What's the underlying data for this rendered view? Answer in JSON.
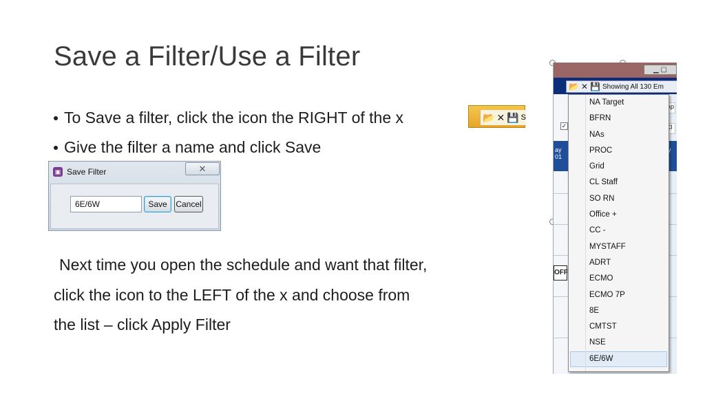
{
  "title": "Save a Filter/Use a Filter",
  "bullets": [
    "To Save a filter, click the icon the RIGHT of the x",
    "Give the filter a name and click Save"
  ],
  "paragraph": [
    "Next time you open the schedule and want that filter,",
    "click the icon to the LEFT of the x and choose from",
    "the list – click Apply Filter"
  ],
  "snippet": {
    "trailing_text": "S"
  },
  "dialog": {
    "title": "Save Filter",
    "name_value": "6E/6W",
    "save_label": "Save",
    "cancel_label": "Cancel"
  },
  "schedule": {
    "showing_text": "Showing All 130 Em",
    "header_left": "ay",
    "header_left_sub": "01",
    "header_right": "y",
    "off_label": "OFF",
    "cell_text_right_1": "Ap",
    "cell_text_right_2": "Cl",
    "filter_list": [
      "NA Target",
      "BFRN",
      "NAs",
      "PROC",
      "Grid",
      "CL Staff",
      "SO RN",
      "Office +",
      "CC -",
      "MYSTAFF",
      "ADRT",
      "ECMO",
      "ECMO 7P",
      "8E",
      "CMTST",
      "NSE",
      "6E/6W"
    ],
    "selected_filter": "6E/6W"
  }
}
